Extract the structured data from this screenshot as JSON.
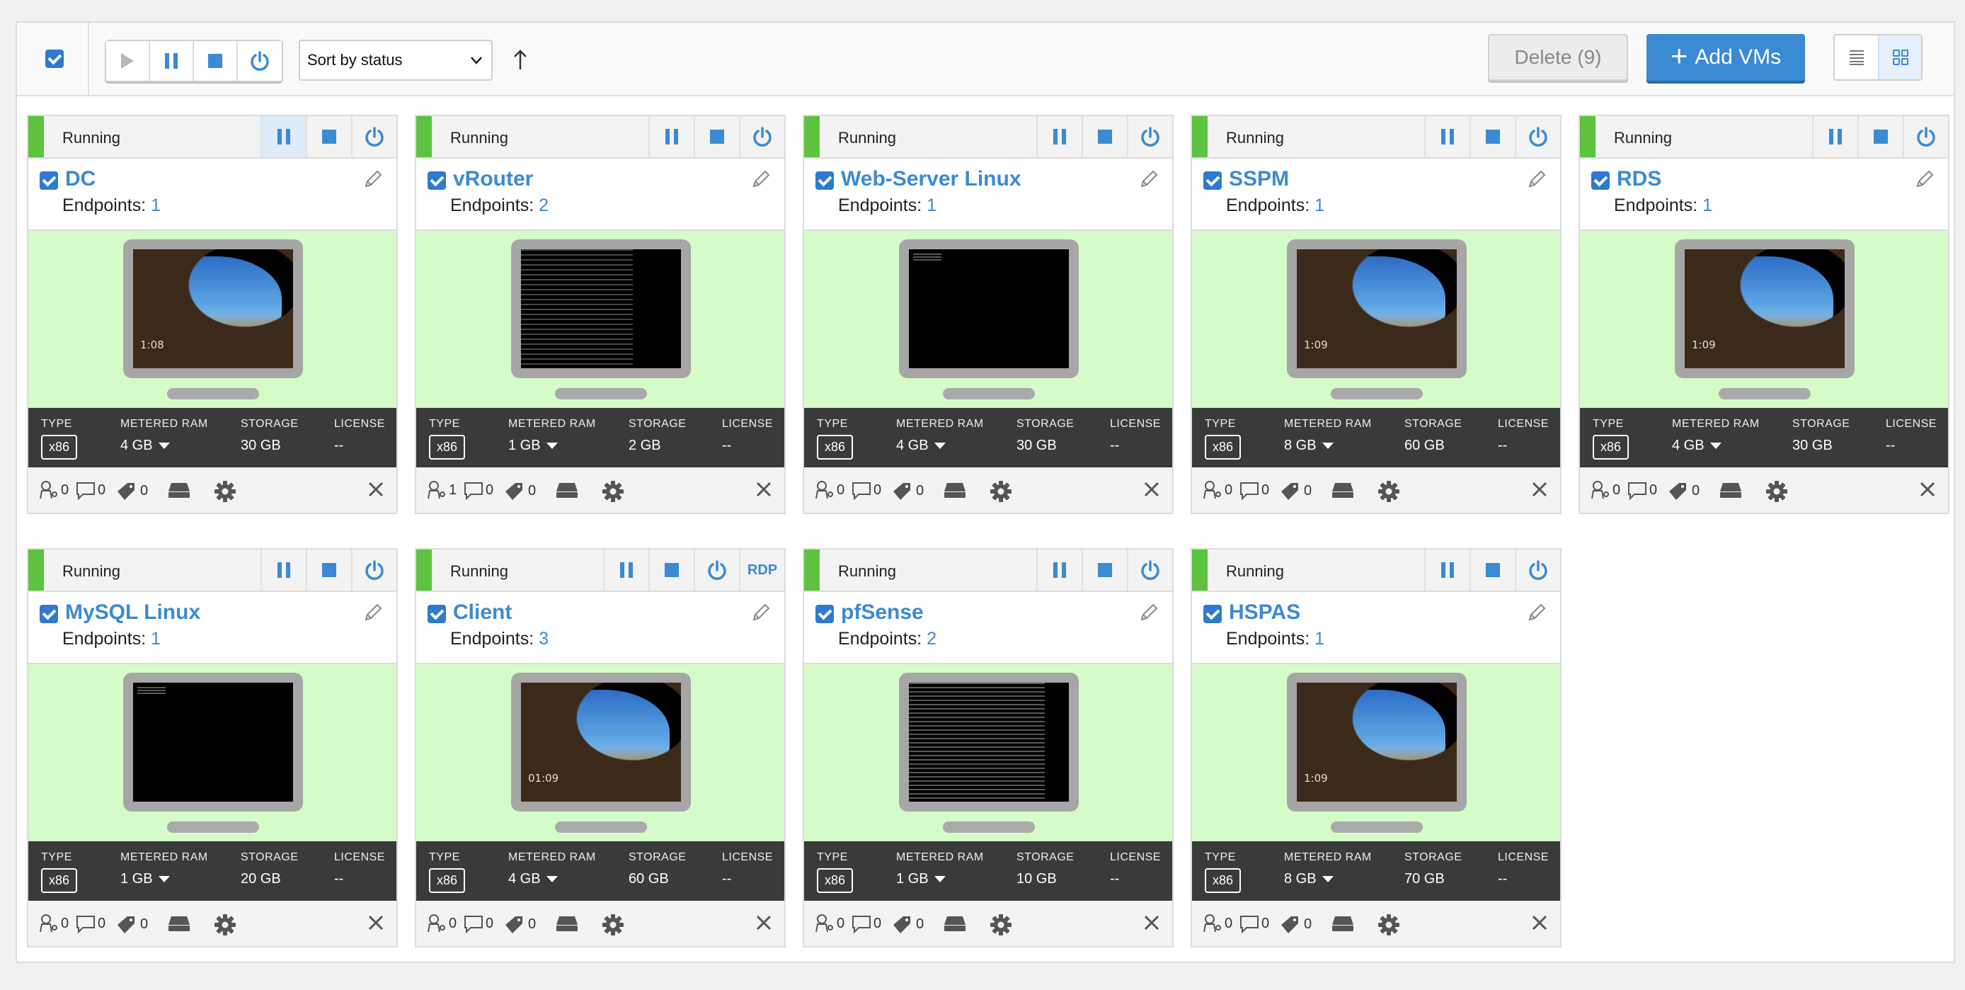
{
  "toolbar": {
    "sort_label": "Sort by status",
    "delete_label": "Delete (9)",
    "add_label": "Add VMs",
    "select_all_checked": true
  },
  "colors": {
    "accent": "#3b8ad4",
    "running_green": "#5cc23f",
    "screen_bg": "#d5fbc9",
    "specs_bg": "#3a3a3a"
  },
  "spec_labels": {
    "type": "TYPE",
    "ram": "METERED RAM",
    "storage": "STORAGE",
    "license": "LICENSE"
  },
  "endpoints_label": "Endpoints:",
  "vms": [
    {
      "status": "Running",
      "name": "DC",
      "endpoints": "1",
      "type": "x86",
      "ram": "4 GB",
      "storage": "30 GB",
      "license": "--",
      "users": "0",
      "comments": "0",
      "tags": "0",
      "screen": "desktop",
      "time": "1:08"
    },
    {
      "status": "Running",
      "name": "vRouter",
      "endpoints": "2",
      "type": "x86",
      "ram": "1 GB",
      "storage": "2 GB",
      "license": "--",
      "users": "1",
      "comments": "0",
      "tags": "0",
      "screen": "terminal"
    },
    {
      "status": "Running",
      "name": "Web-Server Linux",
      "endpoints": "1",
      "type": "x86",
      "ram": "4 GB",
      "storage": "30 GB",
      "license": "--",
      "users": "0",
      "comments": "0",
      "tags": "0",
      "screen": "blank"
    },
    {
      "status": "Running",
      "name": "SSPM",
      "endpoints": "1",
      "type": "x86",
      "ram": "8 GB",
      "storage": "60 GB",
      "license": "--",
      "users": "0",
      "comments": "0",
      "tags": "0",
      "screen": "desktop",
      "time": "1:09"
    },
    {
      "status": "Running",
      "name": "RDS",
      "endpoints": "1",
      "type": "x86",
      "ram": "4 GB",
      "storage": "30 GB",
      "license": "--",
      "users": "0",
      "comments": "0",
      "tags": "0",
      "screen": "desktop",
      "time": "1:09"
    },
    {
      "status": "Running",
      "name": "MySQL Linux",
      "endpoints": "1",
      "type": "x86",
      "ram": "1 GB",
      "storage": "20 GB",
      "license": "--",
      "users": "0",
      "comments": "0",
      "tags": "0",
      "screen": "blank"
    },
    {
      "status": "Running",
      "name": "Client",
      "endpoints": "3",
      "type": "x86",
      "ram": "4 GB",
      "storage": "60 GB",
      "license": "--",
      "users": "0",
      "comments": "0",
      "tags": "0",
      "screen": "desktop",
      "time": "01:09",
      "rdp": "RDP"
    },
    {
      "status": "Running",
      "name": "pfSense",
      "endpoints": "2",
      "type": "x86",
      "ram": "1 GB",
      "storage": "10 GB",
      "license": "--",
      "users": "0",
      "comments": "0",
      "tags": "0",
      "screen": "terminal2"
    },
    {
      "status": "Running",
      "name": "HSPAS",
      "endpoints": "1",
      "type": "x86",
      "ram": "8 GB",
      "storage": "70 GB",
      "license": "--",
      "users": "0",
      "comments": "0",
      "tags": "0",
      "screen": "desktop",
      "time": "1:09"
    }
  ]
}
